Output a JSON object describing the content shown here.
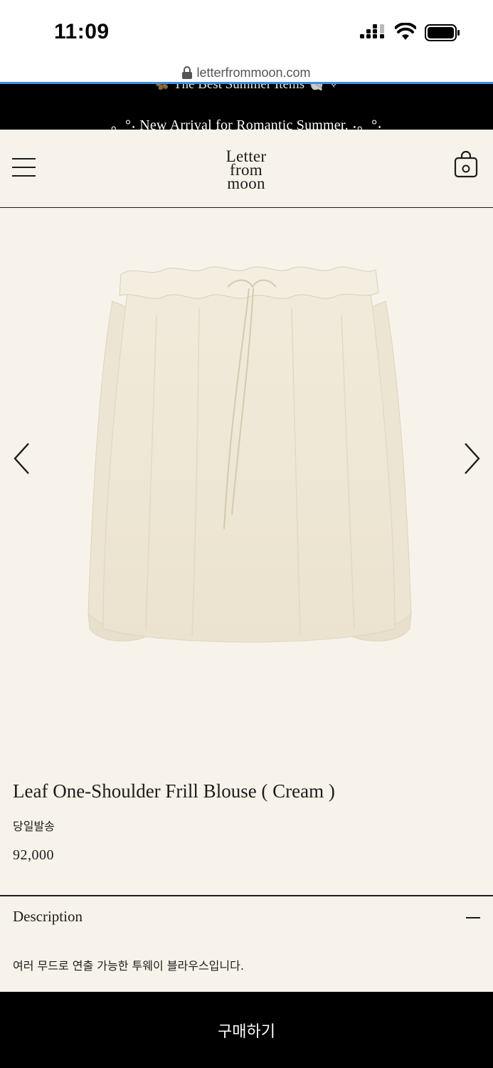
{
  "status_bar": {
    "time": "11:09"
  },
  "browser": {
    "url": "letterfrommoon.com"
  },
  "announcement": {
    "peek_text": "🦋 The Best Summer Items 🐚 ✧",
    "text": "。°˖ New Arrival for Romantic Summer. ˖。°˖"
  },
  "header": {
    "logo_lines": [
      "Letter",
      "from",
      "moon"
    ],
    "icons": {
      "menu": "hamburger-menu-icon",
      "cart": "shopping-bag-icon"
    }
  },
  "gallery": {
    "icons": {
      "prev": "chevron-left-icon",
      "next": "chevron-right-icon"
    },
    "image": "cream-frill-blouse-photo"
  },
  "product": {
    "title": "Leaf One-Shoulder Frill Blouse ( Cream )",
    "shipping_badge": "당일발송",
    "price": "92,000"
  },
  "description": {
    "heading": "Description",
    "body": "여러 무드로 연출 가능한 투웨이 블라우스입니다."
  },
  "buy_button": {
    "label": "구매하기"
  },
  "colors": {
    "background": "#f7f3ea",
    "text": "#1c1c1c",
    "bar": "#000000",
    "progress": "#3f8fe6",
    "blouse": "#efe8d6"
  }
}
